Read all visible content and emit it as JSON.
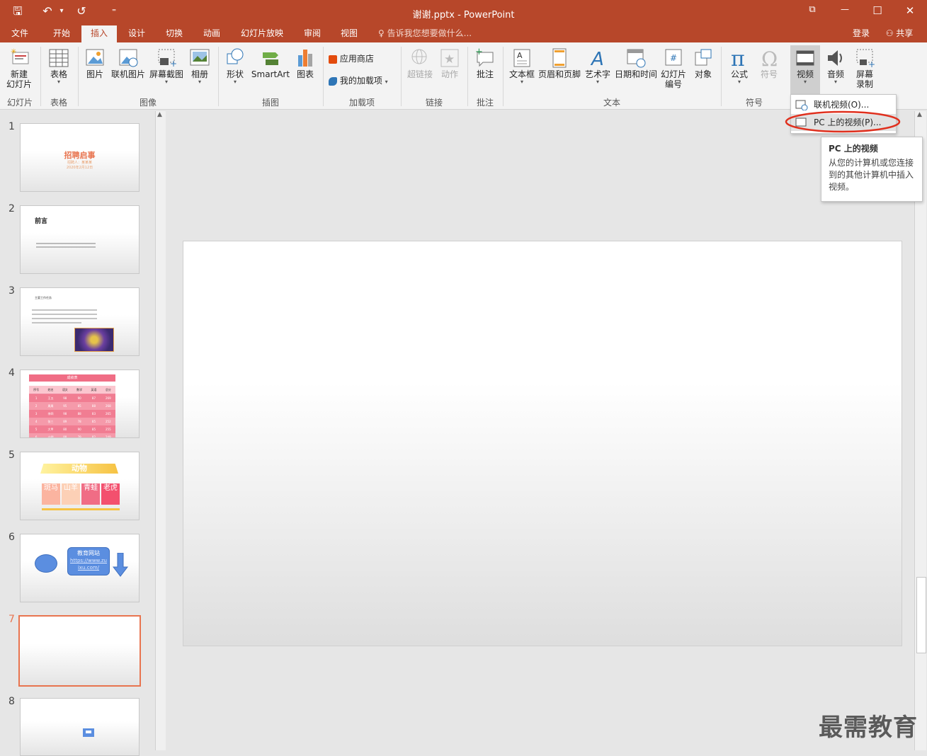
{
  "window": {
    "title": "谢谢.pptx - PowerPoint",
    "qat": {
      "save": "🖫",
      "undo": "↶",
      "undo_caret": "▾",
      "redo": "↺",
      "customize": "⁼"
    },
    "controls": {
      "ribbon_display": "⧉",
      "minimize": "—",
      "maximize": "☐",
      "close": "✕"
    }
  },
  "tabs": [
    "文件",
    "开始",
    "插入",
    "设计",
    "切换",
    "动画",
    "幻灯片放映",
    "审阅",
    "视图"
  ],
  "active_tab": "插入",
  "tell_me": "告诉我您想要做什么...",
  "login": "登录",
  "share": "共享",
  "ribbon": {
    "new_slide": [
      "新建",
      "幻灯片"
    ],
    "table": "表格",
    "picture": "图片",
    "online_picture": "联机图片",
    "screenshot": "屏幕截图",
    "album": "相册",
    "shape": "形状",
    "smartart": "SmartArt",
    "chart": "图表",
    "store": "应用商店",
    "my_addins": "我的加载项",
    "hyperlink": "超链接",
    "action": "动作",
    "comment": "批注",
    "textbox": "文本框",
    "header_footer": "页眉和页脚",
    "wordart": "艺术字",
    "datetime": "日期和时间",
    "slide_number": [
      "幻灯片",
      "编号"
    ],
    "object": "对象",
    "equation": "公式",
    "symbol": "符号",
    "video": "视频",
    "audio": "音频",
    "screen_record": [
      "屏幕",
      "录制"
    ],
    "groups": {
      "slides": "幻灯片",
      "tables": "表格",
      "images": "图像",
      "illustrations": "插图",
      "addins": "加载项",
      "links": "链接",
      "comments": "批注",
      "text": "文本",
      "symbols": "符号"
    }
  },
  "dropdown": {
    "online_video": "联机视频(O)...",
    "pc_video": "PC 上的视频(P)..."
  },
  "tooltip": {
    "title": "PC 上的视频",
    "body": "从您的计算机或您连接到的其他计算机中插入视频。"
  },
  "slides": [
    {
      "n": "1",
      "title": "招聘启事",
      "line1": "招聘人：某某某",
      "line2": "2020年2月12日"
    },
    {
      "n": "2",
      "title": "前言"
    },
    {
      "n": "3",
      "title": "主要工作任务"
    },
    {
      "n": "4",
      "title": "成绩表"
    },
    {
      "n": "5",
      "title": "动物",
      "cells": [
        "斑马",
        "山羊",
        "青蛙",
        "老虎"
      ]
    },
    {
      "n": "6",
      "box": "教育网站",
      "link": "https://www.zuixu.com/"
    },
    {
      "n": "7"
    },
    {
      "n": "8"
    }
  ],
  "score_table": {
    "headers": [
      "序号",
      "姓名",
      "语文",
      "数学",
      "英语",
      "总分"
    ],
    "rows": [
      [
        "1",
        "王五",
        "98",
        "90",
        "87",
        "269"
      ],
      [
        "2",
        "周周",
        "95",
        "85",
        "88",
        "268"
      ],
      [
        "3",
        "李四",
        "98",
        "88",
        "83",
        "265"
      ],
      [
        "4",
        "张三",
        "89",
        "78",
        "85",
        "252"
      ],
      [
        "5",
        "大甲",
        "80",
        "90",
        "85",
        "255"
      ],
      [
        "6",
        "小明",
        "88",
        "79",
        "82",
        "249"
      ]
    ]
  },
  "watermark": "最需教育",
  "colors": {
    "accent": "#b7472a",
    "selected_border": "#e8744f",
    "highlight_circle": "#e0301e"
  }
}
